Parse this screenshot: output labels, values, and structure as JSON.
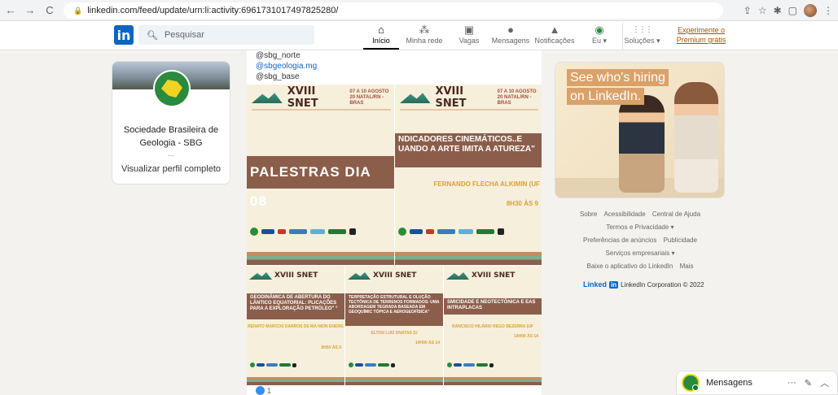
{
  "browser": {
    "url": "linkedin.com/feed/update/urn:li:activity:6961731017497825280/",
    "back_icon": "←",
    "forward_icon": "→",
    "reload_icon": "C",
    "icons": [
      "share-icon",
      "star-icon",
      "extensions-icon",
      "sidebar-icon",
      "profile-avatar",
      "menu-icon"
    ]
  },
  "linkedin_nav": {
    "logo": "in",
    "search_placeholder": "Pesquisar",
    "items": [
      {
        "label": "Início",
        "icon": "home-icon",
        "glyph": "⌂",
        "active": true
      },
      {
        "label": "Minha rede",
        "icon": "network-icon",
        "glyph": "⁂",
        "active": false
      },
      {
        "label": "Vagas",
        "icon": "briefcase-icon",
        "glyph": "▣",
        "active": false
      },
      {
        "label": "Mensagens",
        "icon": "message-icon",
        "glyph": "●",
        "active": false
      },
      {
        "label": "Notificações",
        "icon": "bell-icon",
        "glyph": "▲",
        "active": false
      },
      {
        "label": "Eu ▾",
        "icon": "me-avatar",
        "glyph": "◉",
        "active": false
      },
      {
        "label": "Soluções ▾",
        "icon": "grid-icon",
        "glyph": "⋮⋮⋮",
        "active": false
      }
    ],
    "premium_line1": "Experimente o",
    "premium_line2": "Premium grátis"
  },
  "profile_card": {
    "name_line1": "Sociedade Brasileira de",
    "name_line2": "Geologia - SBG",
    "dots": "...",
    "view_profile": "Visualizar perfil completo"
  },
  "post": {
    "handle1": "@sbg_norte",
    "handle2": "@sbgeologia.mg",
    "handle3": "@sbg_base",
    "reaction_count": "1",
    "tiles": [
      {
        "band": "PALESTRAS DIA 08",
        "speaker": "",
        "hour": ""
      },
      {
        "band": "NDICADORES CINEMÁTICOS..E UANDO A ARTE IMITA A ATUREZA\"",
        "speaker": "FERNANDO FLECHA ALKIMIN (UF",
        "hour": "8H30 ÀS 9"
      },
      {
        "band": "GEODINÂMICA DE ABERTURA DO LÂNTICO EQUATORIAL: PLICAÇÕES PARA A EXPLORAÇÃO PETRÓLEO\" °",
        "speaker": "RENATO MARCOS DARROS DE MA NION ENERG",
        "hour": "8H50 ÀS 9"
      },
      {
        "band": "TERPRETAÇÃO ESTRUTURAL E OLUÇÃO TECTÔNICA DE TERRENOS FORMADOS: UMA ABORDAGEM TEGRADA BASEADA EM GEOQUÍMIC TÓPICA E AEROGEOFÍSICA\"",
        "speaker": "ELTON LUIZ DNATAS (U",
        "hour": "14H00 ÀS 14"
      },
      {
        "band": "SMICIDADE E NEOTECTÔNICA E EAS INTRAPLACAS",
        "speaker": "RANCISCO HILÁRIO REGO BEZERRA (UF",
        "hour": "14H00 ÀS 14"
      }
    ],
    "event_title": "XVIII SNET",
    "event_date": "07 A 10 AGOSTO 20 NATAL/RN - BRAS"
  },
  "ad": {
    "line1": "See who's hiring",
    "line2": "on LinkedIn."
  },
  "footer": {
    "row1": [
      "Sobre",
      "Acessibilidade",
      "Central de Ajuda"
    ],
    "row2": [
      "Termos e Privacidade ▾"
    ],
    "row3": [
      "Preferências de anúncios",
      "Publicidade"
    ],
    "row4": [
      "Serviços empresariais ▾"
    ],
    "row5": [
      "Baixe o aplicativo do LinkedIn",
      "Mais"
    ],
    "corp_word": "Linked",
    "corp_box": "in",
    "corp_text": "LinkedIn Corporation © 2022"
  },
  "messaging": {
    "label": "Mensagens",
    "more": "···",
    "compose": "✎",
    "collapse": "︿"
  }
}
